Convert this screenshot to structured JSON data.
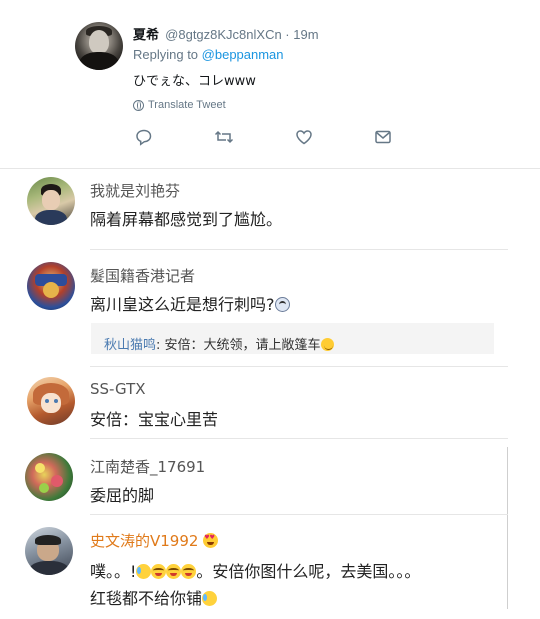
{
  "tweet": {
    "display_name": "夏希",
    "handle_time": "@8gtgz8KJc8nlXCn · 19m",
    "replying_prefix": "Replying to ",
    "replying_to": "@beppanman",
    "text": "ひでぇな、コレwww",
    "translate_label": "Translate Tweet",
    "actions": [
      "reply-icon",
      "retweet-icon",
      "like-icon",
      "share-icon"
    ]
  },
  "comments": [
    {
      "name": "我就是刘艳芬",
      "text": "隔着屏幕都感觉到了尴尬。"
    },
    {
      "name": "髮国籍香港记者",
      "text": "离川皇这么近是想行刺吗?"
    },
    {
      "name": "SS-GTX",
      "text": "安倍：宝宝心里苦"
    },
    {
      "name": "江南楚香_17691",
      "text": "委屈的脚"
    },
    {
      "name": "史文涛的V1992",
      "text_line1_a": "噗。。!",
      "text_line1_b": "。安倍你图什么呢，去美国。。。",
      "text_line2": "红毯都不给你铺"
    }
  ],
  "quote": {
    "name": "秋山猫鸣",
    "text": ": 安倍：大统领，请上敞篷车"
  },
  "colors": {
    "link": "#1b95e0",
    "muted": "#657786",
    "accent_name": "#e07a1a",
    "quote_name": "#4a7ab0"
  }
}
